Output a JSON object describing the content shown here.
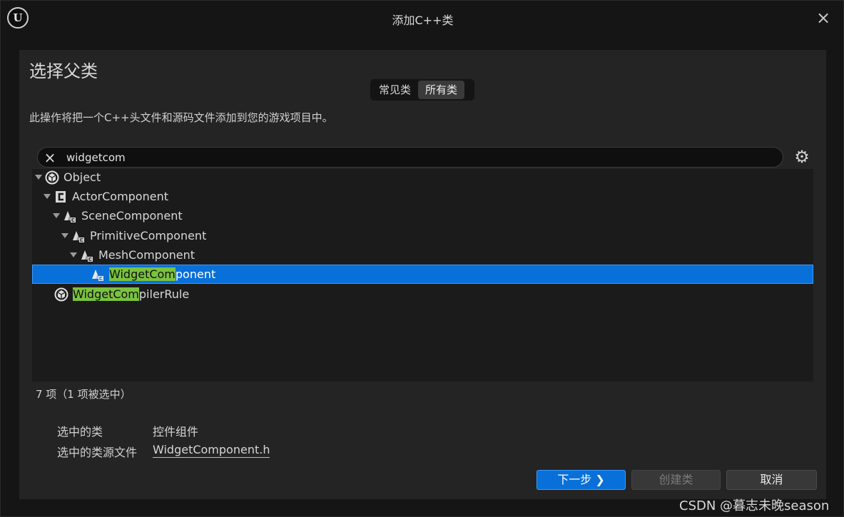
{
  "window": {
    "title": "添加C++类",
    "logo": "U",
    "close_icon": "×"
  },
  "heading": "选择父类",
  "tabs": [
    {
      "label": "常见类",
      "active": false
    },
    {
      "label": "所有类",
      "active": true
    }
  ],
  "description": "此操作将把一个C++头文件和源码文件添加到您的游戏项目中。",
  "search": {
    "value": "widgetcom",
    "clear_icon": "×",
    "settings_icon": "⚙"
  },
  "tree": [
    {
      "name": "Object",
      "icon": "object-icon",
      "expanded": true
    },
    {
      "name": "ActorComponent",
      "icon": "component-class-icon",
      "expanded": true
    },
    {
      "name": "SceneComponent",
      "icon": "scene-component-icon",
      "expanded": true
    },
    {
      "name": "PrimitiveComponent",
      "icon": "scene-component-icon",
      "expanded": true
    },
    {
      "name": "MeshComponent",
      "icon": "scene-component-icon",
      "expanded": true
    },
    {
      "match": "WidgetCom",
      "rest": "ponent",
      "icon": "scene-component-icon",
      "selected": true
    },
    {
      "match": "WidgetCom",
      "rest": "pilerRule",
      "icon": "object-icon",
      "selected": false
    }
  ],
  "count_text": "7 项（1 项被选中）",
  "selected_info": {
    "class_label": "选中的类",
    "class_value": "控件组件",
    "source_label": "选中的类源文件",
    "source_value": "WidgetComponent.h"
  },
  "buttons": {
    "next": "下一步 ❯",
    "create": "创建类",
    "cancel": "取消"
  },
  "watermark": "CSDN @暮志未晚season",
  "colors": {
    "accent": "#0870d8",
    "highlight": "#7ac23f",
    "panel": "#242424"
  }
}
